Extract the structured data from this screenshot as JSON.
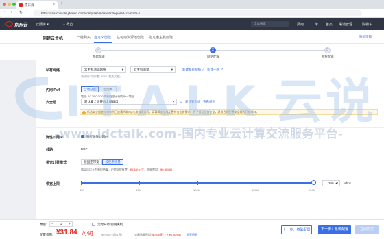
{
  "browser": {
    "tab_title": "京东云",
    "url": "https://cns-console.jdcloud.com/compute/vm/create?regionId=cn-north-1"
  },
  "topnav": {
    "brand": "京东云",
    "menu1": "云服务",
    "menu2": "概览",
    "search_placeholder": "全站搜索",
    "items": [
      "费用",
      "工单",
      "备案",
      "渠道管理",
      "购物车"
    ]
  },
  "header": {
    "title": "创建云主机",
    "tabs": [
      "一键购买",
      "自定义创建",
      "在可用资源池创建",
      "指定宿主机创建"
    ],
    "right_link": "购买须知"
  },
  "steps": [
    {
      "label": "基础配置",
      "state": "done"
    },
    {
      "label": "网络配置",
      "state": "active",
      "num": "2"
    },
    {
      "label": "系统配置",
      "state": "todo",
      "num": "3"
    }
  ],
  "form": {
    "vpc_label": "私有网络",
    "vpc_value": "云主机测试网络",
    "subnet_value": "云主机测试",
    "new_vpc_link": "新建私有网络 ↗",
    "new_subnet_link": "新建子网 ↗",
    "vpc_hint": "该子网可用IP数 4084 (相关文档)",
    "ip_label": "内网IPv4",
    "ip_auto": "自动分配",
    "ip_manual": "指定IP",
    "ip_hint": "地址: 10.30.0.0/20 内网在该子网的IPv4地址",
    "sg_label": "安全组",
    "sg_value": "默认安全组开放全部端口",
    "sg_refresh": "↻",
    "sg_new": "新建安全组",
    "sg_view": "查看规则",
    "warning": "所选安全组会针对实例已放通的端口(IP)来放通访问，请确保安全组配置符合业务需求，为了保证业务安全，建议合理配置安全组的开放端口。",
    "eip_label": "弹性公网IP",
    "eip_check": "购买弹性公网IP",
    "line_label": "线路",
    "line_value": "BGP",
    "billing_label": "带宽计费模式",
    "billing_fixed": "按固定带宽",
    "billing_traffic": "按使用流量",
    "billing_hint": "购买后以天为单位结算，IP地址保有费：",
    "billing_price1": "¥0.48/天/个",
    "billing_mid": "，流量费用：",
    "billing_price2": "¥0.80/GB",
    "bw_label": "带宽上限",
    "bw_value": "200",
    "bw_unit": "Mbps",
    "slider_labels": [
      "1M",
      "50M",
      "100M",
      "150M",
      "200M"
    ]
  },
  "slider": {
    "min": 1,
    "max": 200,
    "value": 200
  },
  "bottom": {
    "qty_label": "数量:",
    "qty_value": "1",
    "renew_label": "定时开停/到期关机",
    "cost_label": "配置费用:",
    "cost_value": "¥31.84",
    "cost_unit": "/小时",
    "cost_sub": "¥0.000/小时(1元)",
    "eip_cost_label": "公网流量费用:",
    "eip_cost_value": "¥0.48/天/个 + ¥0.80/GB",
    "detail_link": "配置明细",
    "prev_btn": "上一步：基础配置",
    "next_btn": "下一步：系统配置",
    "buy_btn": "立即购买"
  },
  "watermark": {
    "logo_text": "ITALK 云说",
    "line": "-www.idctalk.com-国内专业云计算交流服务平台-"
  },
  "colors": {
    "accent": "#3a6fe6",
    "brand": "#e1251b",
    "price": "#e1251b",
    "nav": "#2f3542"
  }
}
